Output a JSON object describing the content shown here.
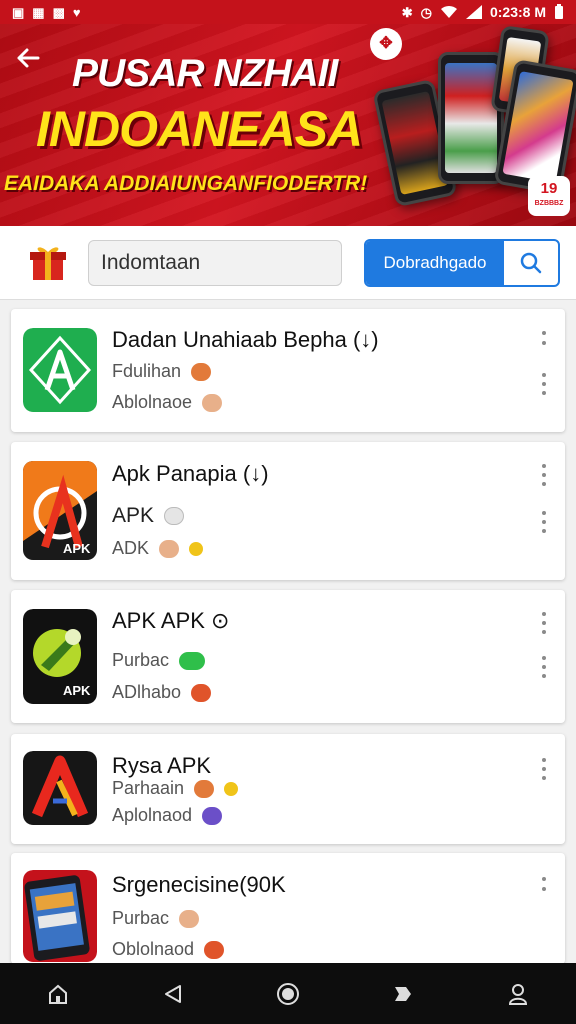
{
  "status_bar": {
    "time": "0:23:8 M",
    "left_icons": [
      "notification-icon",
      "gallery-icon",
      "app-icon",
      "heart-icon"
    ],
    "right_icons": [
      "bluetooth-icon",
      "alarm-icon",
      "wifi-icon",
      "signal-icon",
      "battery-icon"
    ]
  },
  "banner": {
    "title_line1": "PUSAR NZHAII",
    "title_line2": "INDOANEASA",
    "subtitle": "EAIDAKA ADDIAIUNGANFIODERTR!",
    "badge_text": "19",
    "badge_small": "BZBBBZ"
  },
  "search": {
    "value": "Indomtaan",
    "button_label": "Dobradhgado"
  },
  "apps": [
    {
      "title": "Dadan Unahiaab Bepha (↓)",
      "line1": "Fdulihan",
      "line2": "Ablolnaoe"
    },
    {
      "title": "Apk Panapia (↓)",
      "line1": "APK",
      "line2": "ADK",
      "icon_label": "APK"
    },
    {
      "title": "APK APK ⊙",
      "line1": "Purbac",
      "line2": "ADlhabo",
      "icon_label": "APK"
    },
    {
      "title": "Rysa APK",
      "line1": "Parhaain",
      "line2": "Aplolnaod"
    },
    {
      "title": "Srgenecisine(90K",
      "line1": "Purbac",
      "line2": "Oblolnaod"
    }
  ],
  "colors": {
    "brand_red": "#c4121b",
    "accent_yellow": "#ffe31a",
    "button_blue": "#1f7ae0",
    "nav_bg": "#0d0d0d"
  }
}
